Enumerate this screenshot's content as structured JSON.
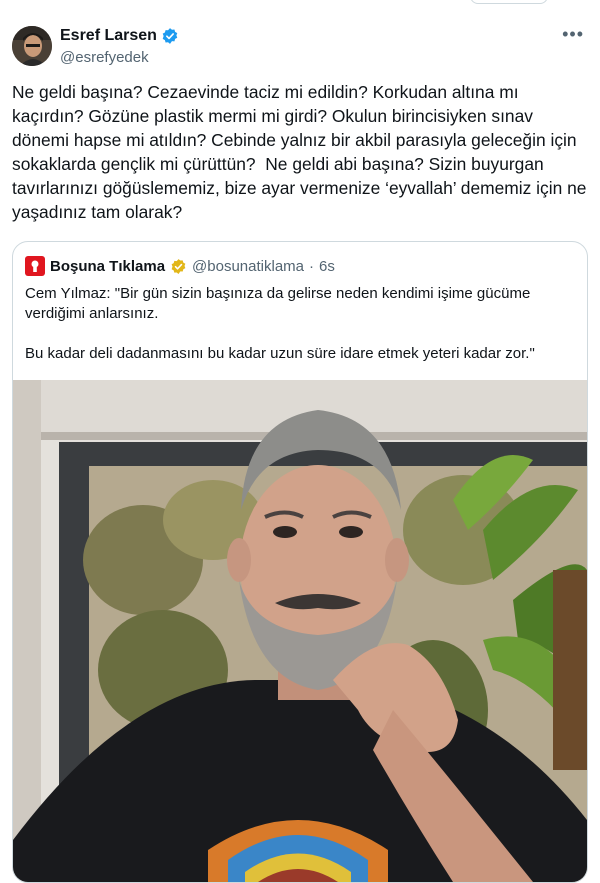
{
  "author": {
    "display_name": "Esref Larsen",
    "handle": "@esrefyedek"
  },
  "more_label": "•••",
  "tweet_text": "Ne geldi başına? Cezaevinde taciz mi edildin? Korkudan altına mı kaçırdın? Gözüne plastik mermi mi girdi? Okulun birincisiyken sınav dönemi hapse mi atıldın? Cebinde yalnız bir akbil parasıyla geleceğin için sokaklarda gençlik mi çürüttün?  Ne geldi abi başına? Sizin buyurgan tavırlarınızı göğüslememiz, bize ayar vermenize ‘eyvallah’ dememiz için ne yaşadınız tam olarak?",
  "quote": {
    "display_name": "Boşuna Tıklama",
    "handle": "@bosunatiklama",
    "separator": "·",
    "time": "6s",
    "text": "Cem Yılmaz: \"Bir gün sizin başınıza da gelirse neden kendimi işime gücüme verdiğimi anlarsınız.\n\nBu kadar deli dadanmasını bu kadar uzun süre idare etmek yeteri kadar zor.\""
  },
  "colors": {
    "verified_blue": "#1d9bf0",
    "verified_gold": "#e2b719",
    "logo_red": "#e0161f",
    "text_primary": "#0f1419",
    "text_secondary": "#536471",
    "border": "#cfd9de"
  },
  "icons": [
    "verified-badge-icon",
    "more-options-icon",
    "quote-logo-icon",
    "gold-verified-badge-icon"
  ]
}
